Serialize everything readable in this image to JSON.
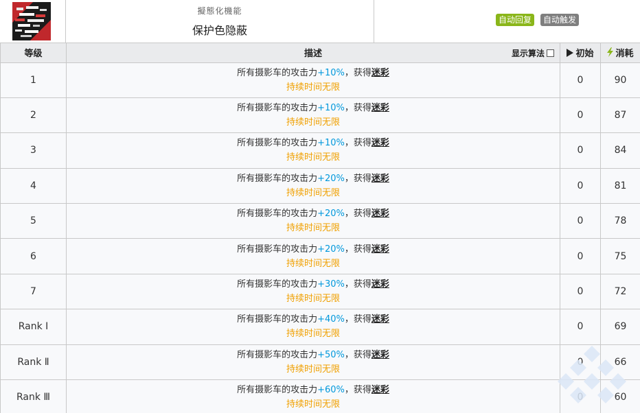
{
  "skill": {
    "icon": "skill-camouflage-icon",
    "subtitle": "擬態化機能",
    "name": "保护色隐蔽",
    "tags": [
      {
        "label": "自动回复",
        "color": "#8ab61a"
      },
      {
        "label": "自动触发",
        "color": "#7f7f7f"
      }
    ]
  },
  "table": {
    "headers": {
      "level": "等级",
      "desc": "描述",
      "show_algo": "显示算法",
      "init": "初始",
      "cost": "消耗"
    },
    "rows": [
      {
        "level": "1",
        "pre": "所有摄影车的攻击力",
        "value": "+10%",
        "mid": "，获得",
        "keyword": "迷彩",
        "duration": "持续时间无限",
        "init": "0",
        "cost": "90"
      },
      {
        "level": "2",
        "pre": "所有摄影车的攻击力",
        "value": "+10%",
        "mid": "，获得",
        "keyword": "迷彩",
        "duration": "持续时间无限",
        "init": "0",
        "cost": "87"
      },
      {
        "level": "3",
        "pre": "所有摄影车的攻击力",
        "value": "+10%",
        "mid": "，获得",
        "keyword": "迷彩",
        "duration": "持续时间无限",
        "init": "0",
        "cost": "84"
      },
      {
        "level": "4",
        "pre": "所有摄影车的攻击力",
        "value": "+20%",
        "mid": "，获得",
        "keyword": "迷彩",
        "duration": "持续时间无限",
        "init": "0",
        "cost": "81"
      },
      {
        "level": "5",
        "pre": "所有摄影车的攻击力",
        "value": "+20%",
        "mid": "，获得",
        "keyword": "迷彩",
        "duration": "持续时间无限",
        "init": "0",
        "cost": "78"
      },
      {
        "level": "6",
        "pre": "所有摄影车的攻击力",
        "value": "+20%",
        "mid": "，获得",
        "keyword": "迷彩",
        "duration": "持续时间无限",
        "init": "0",
        "cost": "75"
      },
      {
        "level": "7",
        "pre": "所有摄影车的攻击力",
        "value": "+30%",
        "mid": "，获得",
        "keyword": "迷彩",
        "duration": "持续时间无限",
        "init": "0",
        "cost": "72"
      },
      {
        "level": "Rank Ⅰ",
        "pre": "所有摄影车的攻击力",
        "value": "+40%",
        "mid": "，获得",
        "keyword": "迷彩",
        "duration": "持续时间无限",
        "init": "0",
        "cost": "69"
      },
      {
        "level": "Rank Ⅱ",
        "pre": "所有摄影车的攻击力",
        "value": "+50%",
        "mid": "，获得",
        "keyword": "迷彩",
        "duration": "持续时间无限",
        "init": "0",
        "cost": "66"
      },
      {
        "level": "Rank Ⅲ",
        "pre": "所有摄影车的攻击力",
        "value": "+60%",
        "mid": "，获得",
        "keyword": "迷彩",
        "duration": "持续时间无限",
        "init": "0",
        "cost": "60"
      }
    ]
  },
  "colors": {
    "value_highlight": "#0098dc",
    "duration": "#f0a000",
    "cost_icon": "#8ab61a"
  }
}
